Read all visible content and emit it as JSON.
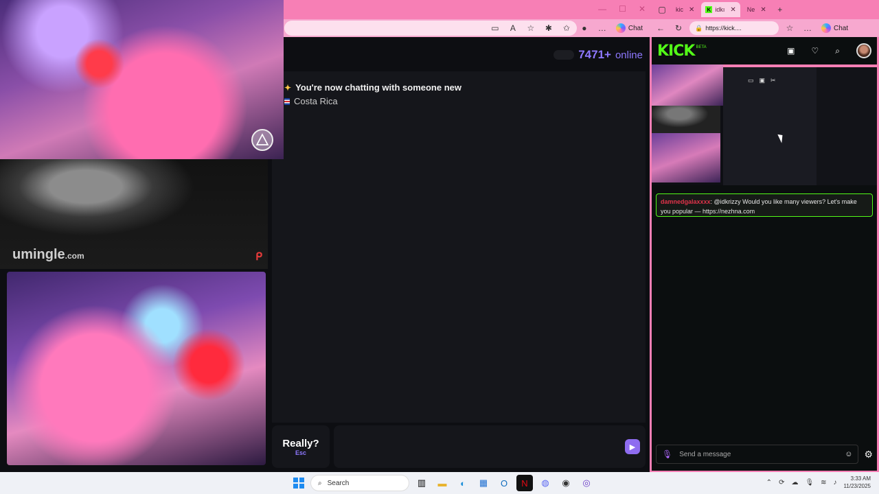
{
  "left_browser": {
    "chat_label": "Chat",
    "online_count": "7471+",
    "online_label": "online",
    "system_message": "You're now chatting with someone new",
    "country": "Costa Rica",
    "really_label": "Really?",
    "esc_label": "Esc",
    "watermark": "umingle",
    "watermark_domain": ".com"
  },
  "right_browser": {
    "tabs": [
      {
        "label": "kic"
      },
      {
        "label": "idkı"
      },
      {
        "label": "Ne"
      }
    ],
    "address": "https://kick....",
    "chat_label": "Chat",
    "kick": {
      "logo": "KICK",
      "beta": "BETA",
      "chat_message": {
        "user": "damnedgalaxxxx",
        "text": ": @idkrizzy Would you like many viewers? Let's make you popular — https://nezhna.com"
      },
      "send_placeholder": "Send a message"
    }
  },
  "taskbar": {
    "search_label": "Search",
    "time": "3:33 AM",
    "date": "11/23/2025"
  },
  "colors": {
    "accent_pink": "#f77fb5",
    "kick_green": "#53fc18",
    "online_purple": "#8e78ff"
  }
}
